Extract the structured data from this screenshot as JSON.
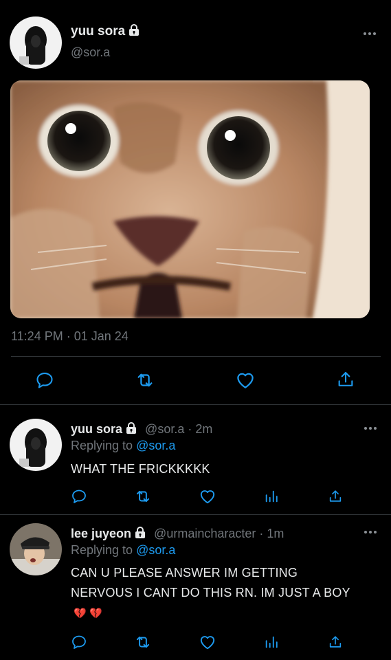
{
  "main_tweet": {
    "name": "yuu sora",
    "handle": "@sor.a",
    "timestamp": "11:24 PM · 01 Jan 24",
    "media_icon": "startled-cat-photo"
  },
  "replies": [
    {
      "name": "yuu sora",
      "meta": "@sor.a · 2m",
      "replying_label": "Replying to",
      "replying_to": "@sor.a",
      "text": "WHAT THE FRICKKKKK"
    },
    {
      "name": "lee juyeon",
      "meta": "@urmaincharacter · 1m",
      "replying_label": "Replying to",
      "replying_to": "@sor.a",
      "text": "CAN U PLEASE ANSWER IM GETTING NERVOUS I CANT DO THIS RN. IM JUST A BOY",
      "emoji": "💔 💔"
    }
  ],
  "icons": [
    "reply-icon",
    "retweet-icon",
    "like-icon",
    "share-icon",
    "analytics-icon",
    "lock-icon",
    "more-icon"
  ],
  "colors": {
    "background": "#000000",
    "text": "#e7e9ea",
    "muted": "#71767b",
    "link": "#1d9bf0",
    "divider": "#2f3336"
  }
}
